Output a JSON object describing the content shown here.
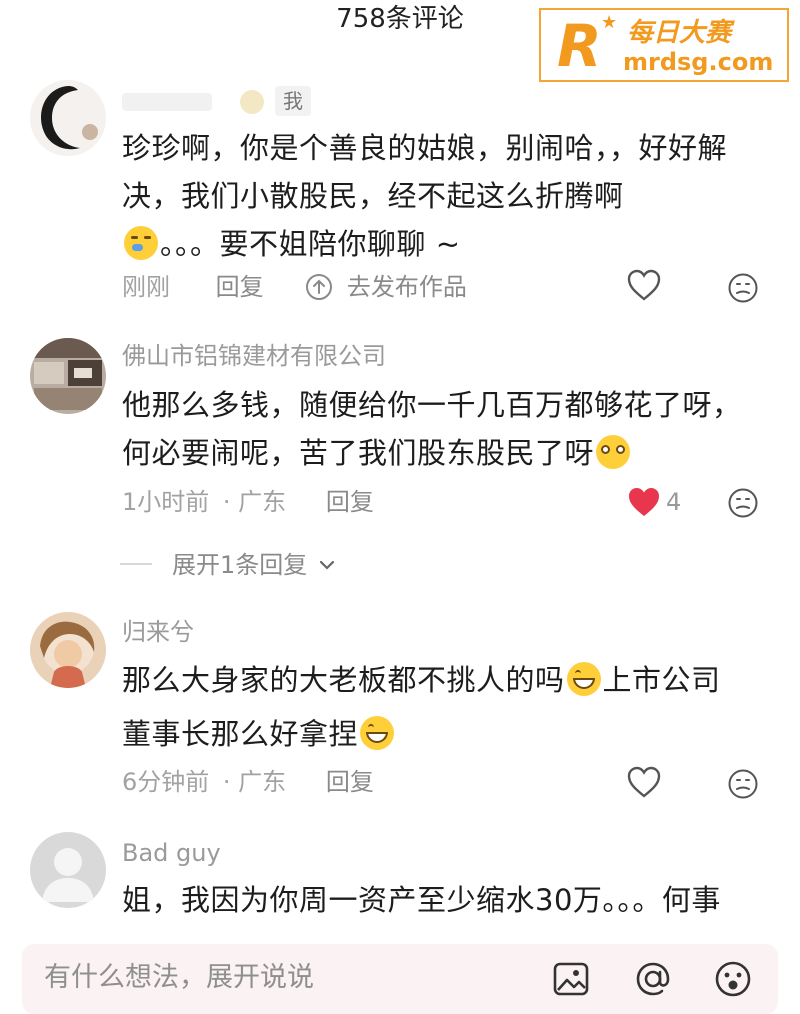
{
  "header": {
    "title": "758条评论"
  },
  "watermark": {
    "letter": "R",
    "name": "每日大赛",
    "url": "mrdsg.com"
  },
  "comments": [
    {
      "name": "",
      "tag": "我",
      "body": [
        "珍珍啊，你是个善良的姑娘，别闹哈，，好好解",
        "决，我们小散股民，经不起这么折腾啊",
        "。。。要不姐陪你聊聊 ~"
      ],
      "time": "刚刚",
      "reply": "回复",
      "publish": "去发布作品",
      "likes": ""
    },
    {
      "name": "佛山市铝锦建材有限公司",
      "body": [
        "他那么多钱，随便给你一千几百万都够花了呀，",
        "何必要闹呢，苦了我们股东股民了呀"
      ],
      "time": "1小时前",
      "location": "· 广东",
      "reply": "回复",
      "likes": "4",
      "expand": "展开1条回复"
    },
    {
      "name": "归来兮",
      "body": [
        "那么大身家的大老板都不挑人的吗",
        "上市公司",
        "董事长那么好拿捏"
      ],
      "time": "6分钟前",
      "location": "· 广东",
      "reply": "回复"
    },
    {
      "name": "Bad guy",
      "body": [
        "姐，我因为你周一资产至少缩水30万。。。何事"
      ]
    }
  ],
  "input": {
    "placeholder": "有什么想法，展开说说"
  },
  "colors": {
    "accent": "#f29a1f",
    "like": "#e8364e",
    "muted": "#a2a2a2"
  }
}
